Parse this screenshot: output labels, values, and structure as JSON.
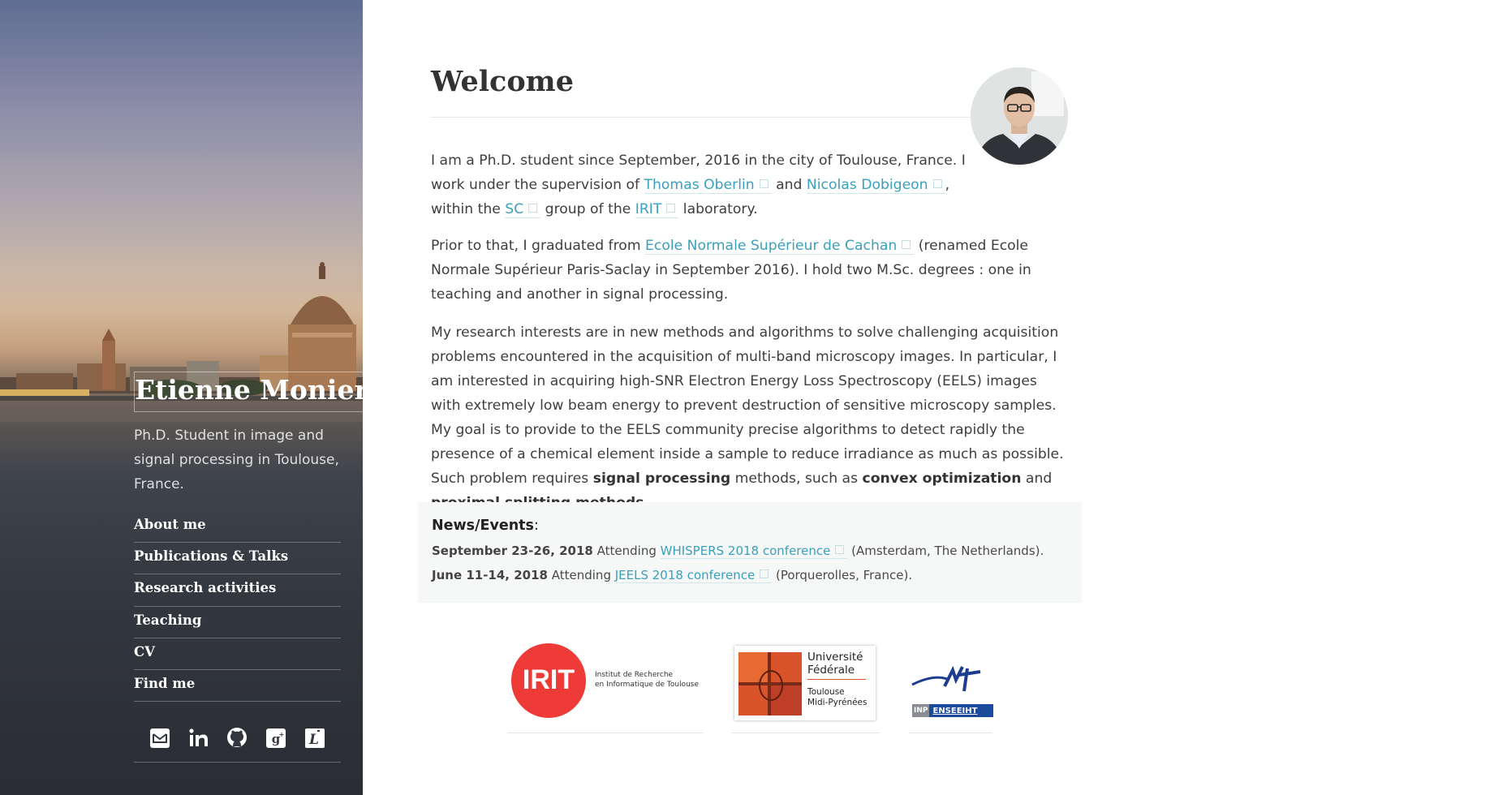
{
  "sidebar": {
    "title": "Etienne Monier",
    "tagline": "Ph.D. Student in image and signal processing in Toulouse, France.",
    "nav": [
      {
        "label": "About me"
      },
      {
        "label": "Publications & Talks"
      },
      {
        "label": "Research activities"
      },
      {
        "label": "Teaching"
      },
      {
        "label": "CV"
      },
      {
        "label": "Find me"
      }
    ],
    "social": [
      "mail-icon",
      "linkedin-icon",
      "github-icon",
      "google-plus-icon",
      "latex-icon"
    ]
  },
  "main": {
    "title": "Welcome",
    "p1": {
      "t1": "I am a Ph.D. student since September, 2016 in the city of Toulouse, France. I work under the supervision of ",
      "l1": "Thomas Oberlin",
      "t2": " and ",
      "l2": "Nicolas Dobigeon",
      "t3": ", within the ",
      "l3": "SC",
      "t4": " group of the ",
      "l4": "IRIT",
      "t5": " laboratory."
    },
    "p2": {
      "t1": "Prior to that, I graduated from ",
      "l1": "Ecole Normale Supérieur de Cachan",
      "t2": " (renamed Ecole Normale Supérieur Paris-Saclay in September 2016). I hold two M.Sc. degrees : one in teaching and another in signal processing."
    },
    "p3": {
      "t1": "My research interests are in new methods and algorithms to solve challenging acquisition problems encountered in the acquisition of multi-band microscopy images. In particular, I am interested in acquiring high-SNR Electron Energy Loss Spectroscopy (EELS) images with extremely low beam energy to prevent destruction of sensitive microscopy samples. My goal is to provide to the EELS community precise algorithms to detect rapidly the presence of a chemical element inside a sample to reduce irradiance as much as possible. Such problem requires ",
      "b1": "signal processing",
      "t2": " methods, such as ",
      "b2": "convex optimization",
      "t3": " and ",
      "b3": "proximal splitting methods",
      "t4": "."
    },
    "news": {
      "title": "News/Events",
      "colon": ":",
      "items": [
        {
          "date": "September 23-26, 2018",
          "pre": " Attending ",
          "link": "WHISPERS 2018 conference",
          "post": " (Amsterdam, The Netherlands)."
        },
        {
          "date": "June 11-14, 2018",
          "pre": " Attending ",
          "link": "JEELS 2018 conference",
          "post": " (Porquerolles, France)."
        }
      ]
    },
    "logos": {
      "irit": {
        "mark": "IRIT",
        "line1": "Institut de Recherche",
        "line2": "en Informatique de Toulouse"
      },
      "uftmp": {
        "line1": "Université",
        "line2": "Fédérale",
        "line3": "Toulouse",
        "line4": "Midi-Pyrénées"
      },
      "enseeiht": {
        "inp": "INP",
        "name": "ENSEEIHT"
      }
    }
  }
}
